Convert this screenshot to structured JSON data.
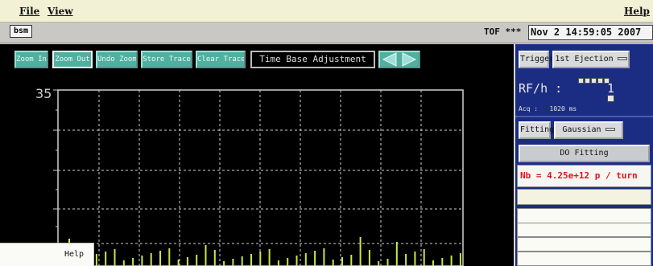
{
  "menubar": {
    "file_label": "File",
    "view_label": "View",
    "help_label": "Help"
  },
  "info_row": {
    "tab_label": "bsm",
    "tof_label": "TOF ***",
    "datetime": "Nov  2 14:59:05 2007"
  },
  "toolbar": {
    "zoom_in": "Zoom In",
    "zoom_out": "Zoom Out",
    "undo_zoom": "Undo Zoom",
    "store_trace": "Store Trace",
    "clear_trace": "Clear Trace",
    "time_base_label": "Time Base Adjustment"
  },
  "plot": {
    "y_top_label": "35",
    "trace_color": "#c8e64b",
    "grid_color": "#cfcfcf",
    "background": "#000000"
  },
  "right_panel": {
    "trigger_label": "Trigger",
    "trigger_value": "1st Ejection",
    "rfh_label": "RF/h :",
    "rfh_value": "1",
    "acq_text": "Acq :   1020 ms",
    "fitting_label": "Fitting",
    "fitting_value": "Gaussian",
    "do_fitting_label": "DO Fitting",
    "nb_text": "Nb = 4.25e+12 p / turn",
    "nb_color": "#e0141b",
    "panel_color": "#1a2d83"
  },
  "help_popup": {
    "label": "Help"
  },
  "icons": {
    "arrow_left": "triangle-left-icon",
    "arrow_right": "triangle-right-icon"
  }
}
